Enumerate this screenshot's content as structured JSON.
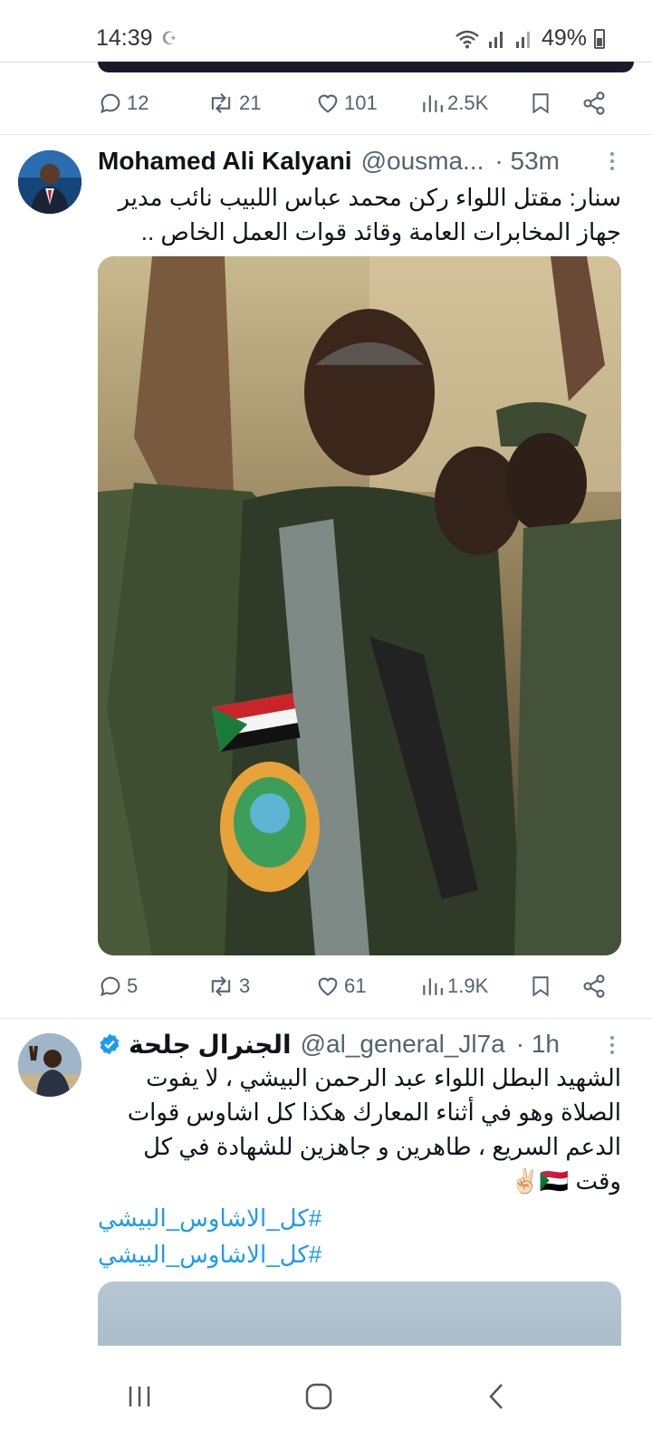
{
  "status_bar": {
    "time": "14:39",
    "battery": "49%",
    "battery_level": 0.49
  },
  "previous_tweet": {
    "actions": {
      "replies": "12",
      "retweets": "21",
      "likes": "101",
      "views": "2.5K"
    }
  },
  "tweet1": {
    "display_name": "Mohamed Ali Kalyani",
    "handle": "@ousma...",
    "time": "· 53m",
    "text": "سنار: مقتل اللواء ركن محمد عباس اللبيب نائب مدير جهاز المخابرات العامة وقائد قوات العمل الخاص ..",
    "actions": {
      "replies": "5",
      "retweets": "3",
      "likes": "61",
      "views": "1.9K"
    }
  },
  "tweet2": {
    "display_name": "الجنرال جلحة",
    "verified": true,
    "handle": "@al_general_Jl7a",
    "time": "· 1h",
    "text": "الشهيد البطل اللواء عبد الرحمن البيشي ، لا يفوت الصلاة وهو في أثناء المعارك هكذا كل اشاوس قوات الدعم السريع ، طاهرين و جاهزين للشهادة في كل وقت 🇸🇩✌🏻",
    "hashtags": [
      "#كل_الاشاوس_البيشي",
      "#كل_الاشاوس_البيشي"
    ]
  },
  "colors": {
    "accent": "#1d9bf0",
    "secondary_text": "#536471",
    "divider": "#e1e6ea"
  }
}
